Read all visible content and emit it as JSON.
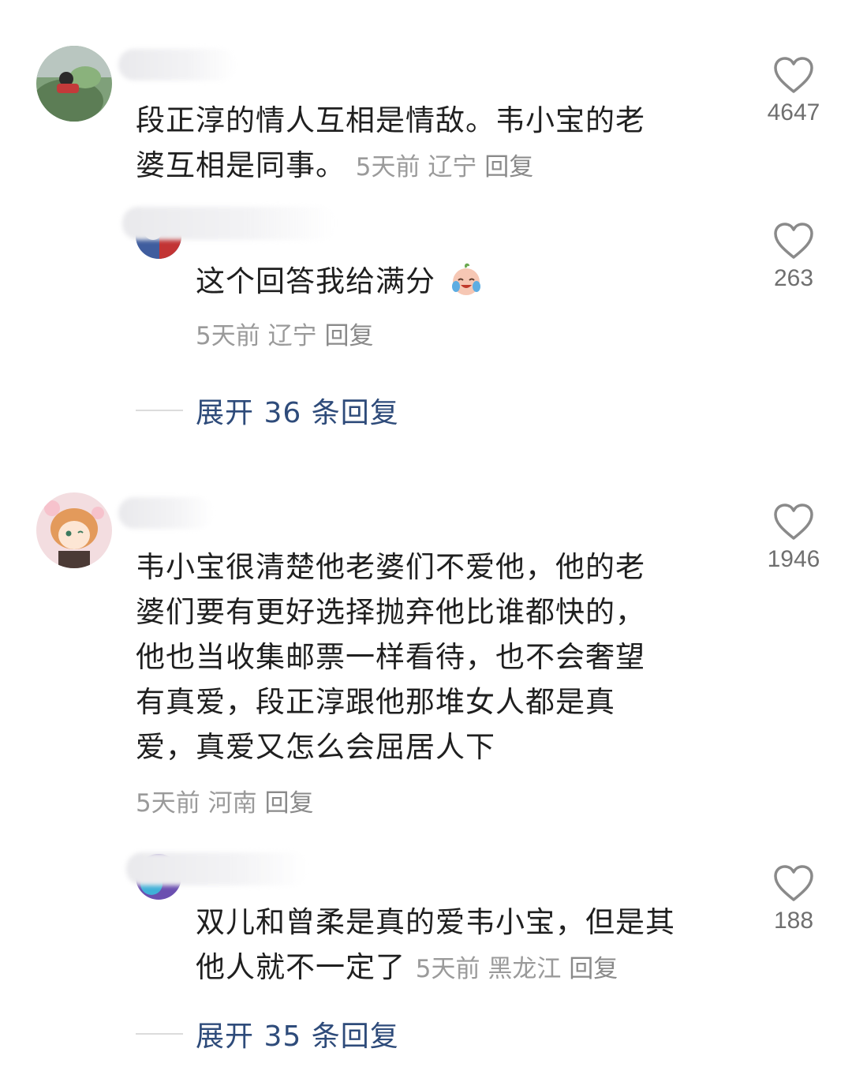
{
  "comments": [
    {
      "text": "段正淳的情人互相是情敌。韦小宝的老婆互相是同事。",
      "line1": "段正淳的情人互相是情敌。韦小宝的老",
      "line2": "婆互相是同事。",
      "time": "5天前",
      "location": "辽宁",
      "reply": "回复",
      "likes": "4647",
      "reply_comment": {
        "text": "这个回答我给满分",
        "emoji": "crying-laughing-emoji",
        "time": "5天前",
        "location": "辽宁",
        "reply": "回复",
        "likes": "263"
      },
      "expand_label": "展开 36 条回复"
    },
    {
      "lines": [
        "韦小宝很清楚他老婆们不爱他，他的老",
        "婆们要有更好选择抛弃他比谁都快的，",
        "他也当收集邮票一样看待，也不会奢望",
        "有真爱，段正淳跟他那堆女人都是真",
        "爱，真爱又怎么会屈居人下"
      ],
      "time": "5天前",
      "location": "河南",
      "reply": "回复",
      "likes": "1946",
      "reply_comment": {
        "line1": "双儿和曾柔是真的爱韦小宝，但是其",
        "line2": "他人就不一定了",
        "time": "5天前",
        "location": "黑龙江",
        "reply": "回复",
        "likes": "188"
      },
      "expand_label": "展开 35 条回复"
    }
  ],
  "icons": {
    "like": "heart-outline-icon"
  },
  "colors": {
    "link": "#2e4b7a",
    "meta": "#9a9a9a",
    "text": "#1f1f1f"
  }
}
